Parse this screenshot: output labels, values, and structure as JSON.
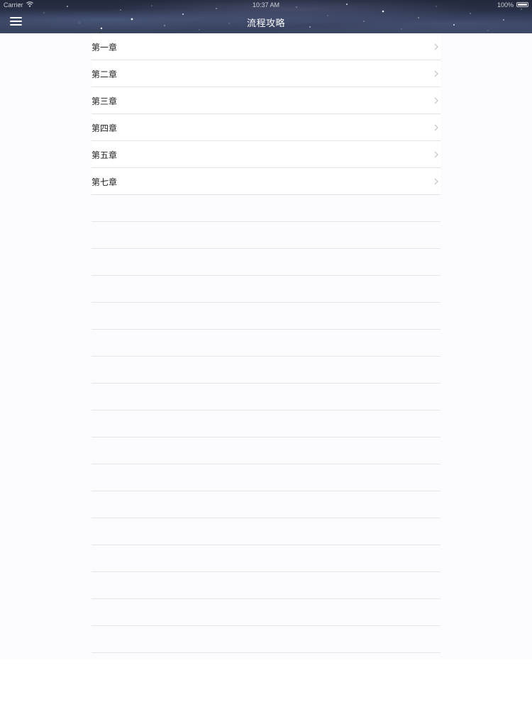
{
  "status_bar": {
    "carrier": "Carrier",
    "time": "10:37 AM",
    "battery": "100%"
  },
  "navbar": {
    "title": "流程攻略",
    "menu_icon": "hamburger-menu-icon"
  },
  "chapters": [
    {
      "label": "第一章"
    },
    {
      "label": "第二章"
    },
    {
      "label": "第三章"
    },
    {
      "label": "第四章"
    },
    {
      "label": "第五章"
    },
    {
      "label": "第七章"
    }
  ],
  "colors": {
    "nav_background": "#2d3650",
    "separator": "#e3e3e6",
    "chevron": "#c7c7cc",
    "text": "#222222"
  }
}
